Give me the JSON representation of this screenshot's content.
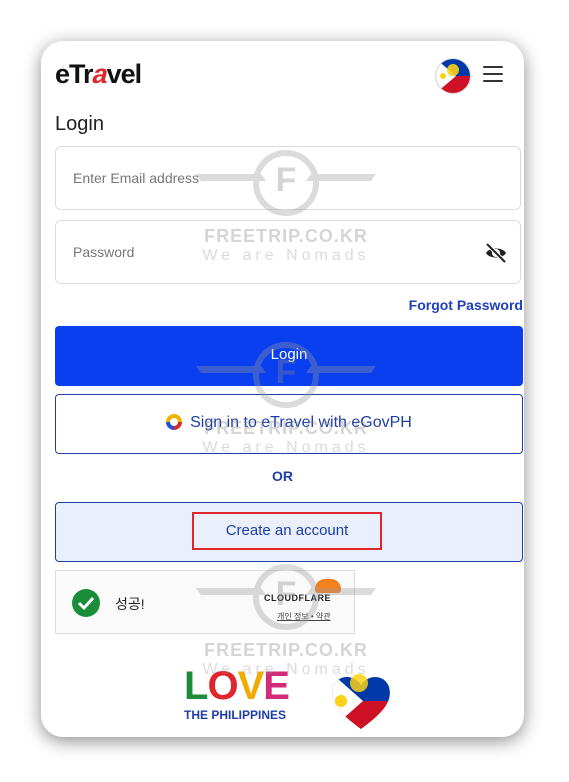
{
  "app": {
    "logo": {
      "prefix": "eTr",
      "accent": "a",
      "suffix": "vel"
    },
    "brand_colors": {
      "primary": "#0a3ff0",
      "accent": "#e0262d",
      "link": "#1f3fbf"
    }
  },
  "header": {
    "avatar_icon": "philippines-flag-icon",
    "menu_icon": "hamburger-menu-icon"
  },
  "login": {
    "title": "Login",
    "email": {
      "placeholder": "Enter Email address",
      "value": ""
    },
    "password": {
      "placeholder": "Password",
      "value": "",
      "toggle_icon": "eye-off-icon"
    },
    "forgot_label": "Forgot Password",
    "login_button": "Login",
    "egov_button": "Sign in to eTravel with eGovPH",
    "or_label": "OR",
    "create_account_button": "Create an account"
  },
  "captcha": {
    "status_text": "성공!",
    "provider": "CLOUDFLARE",
    "links": "개인 정보 • 약관"
  },
  "footer": {
    "love_text": [
      "L",
      "O",
      "V",
      "E"
    ],
    "tagline": "THE PHILIPPINES"
  },
  "watermark": {
    "site": "FREETRIP.CO.KR",
    "slogan": "We are Nomads",
    "letter": "F"
  }
}
